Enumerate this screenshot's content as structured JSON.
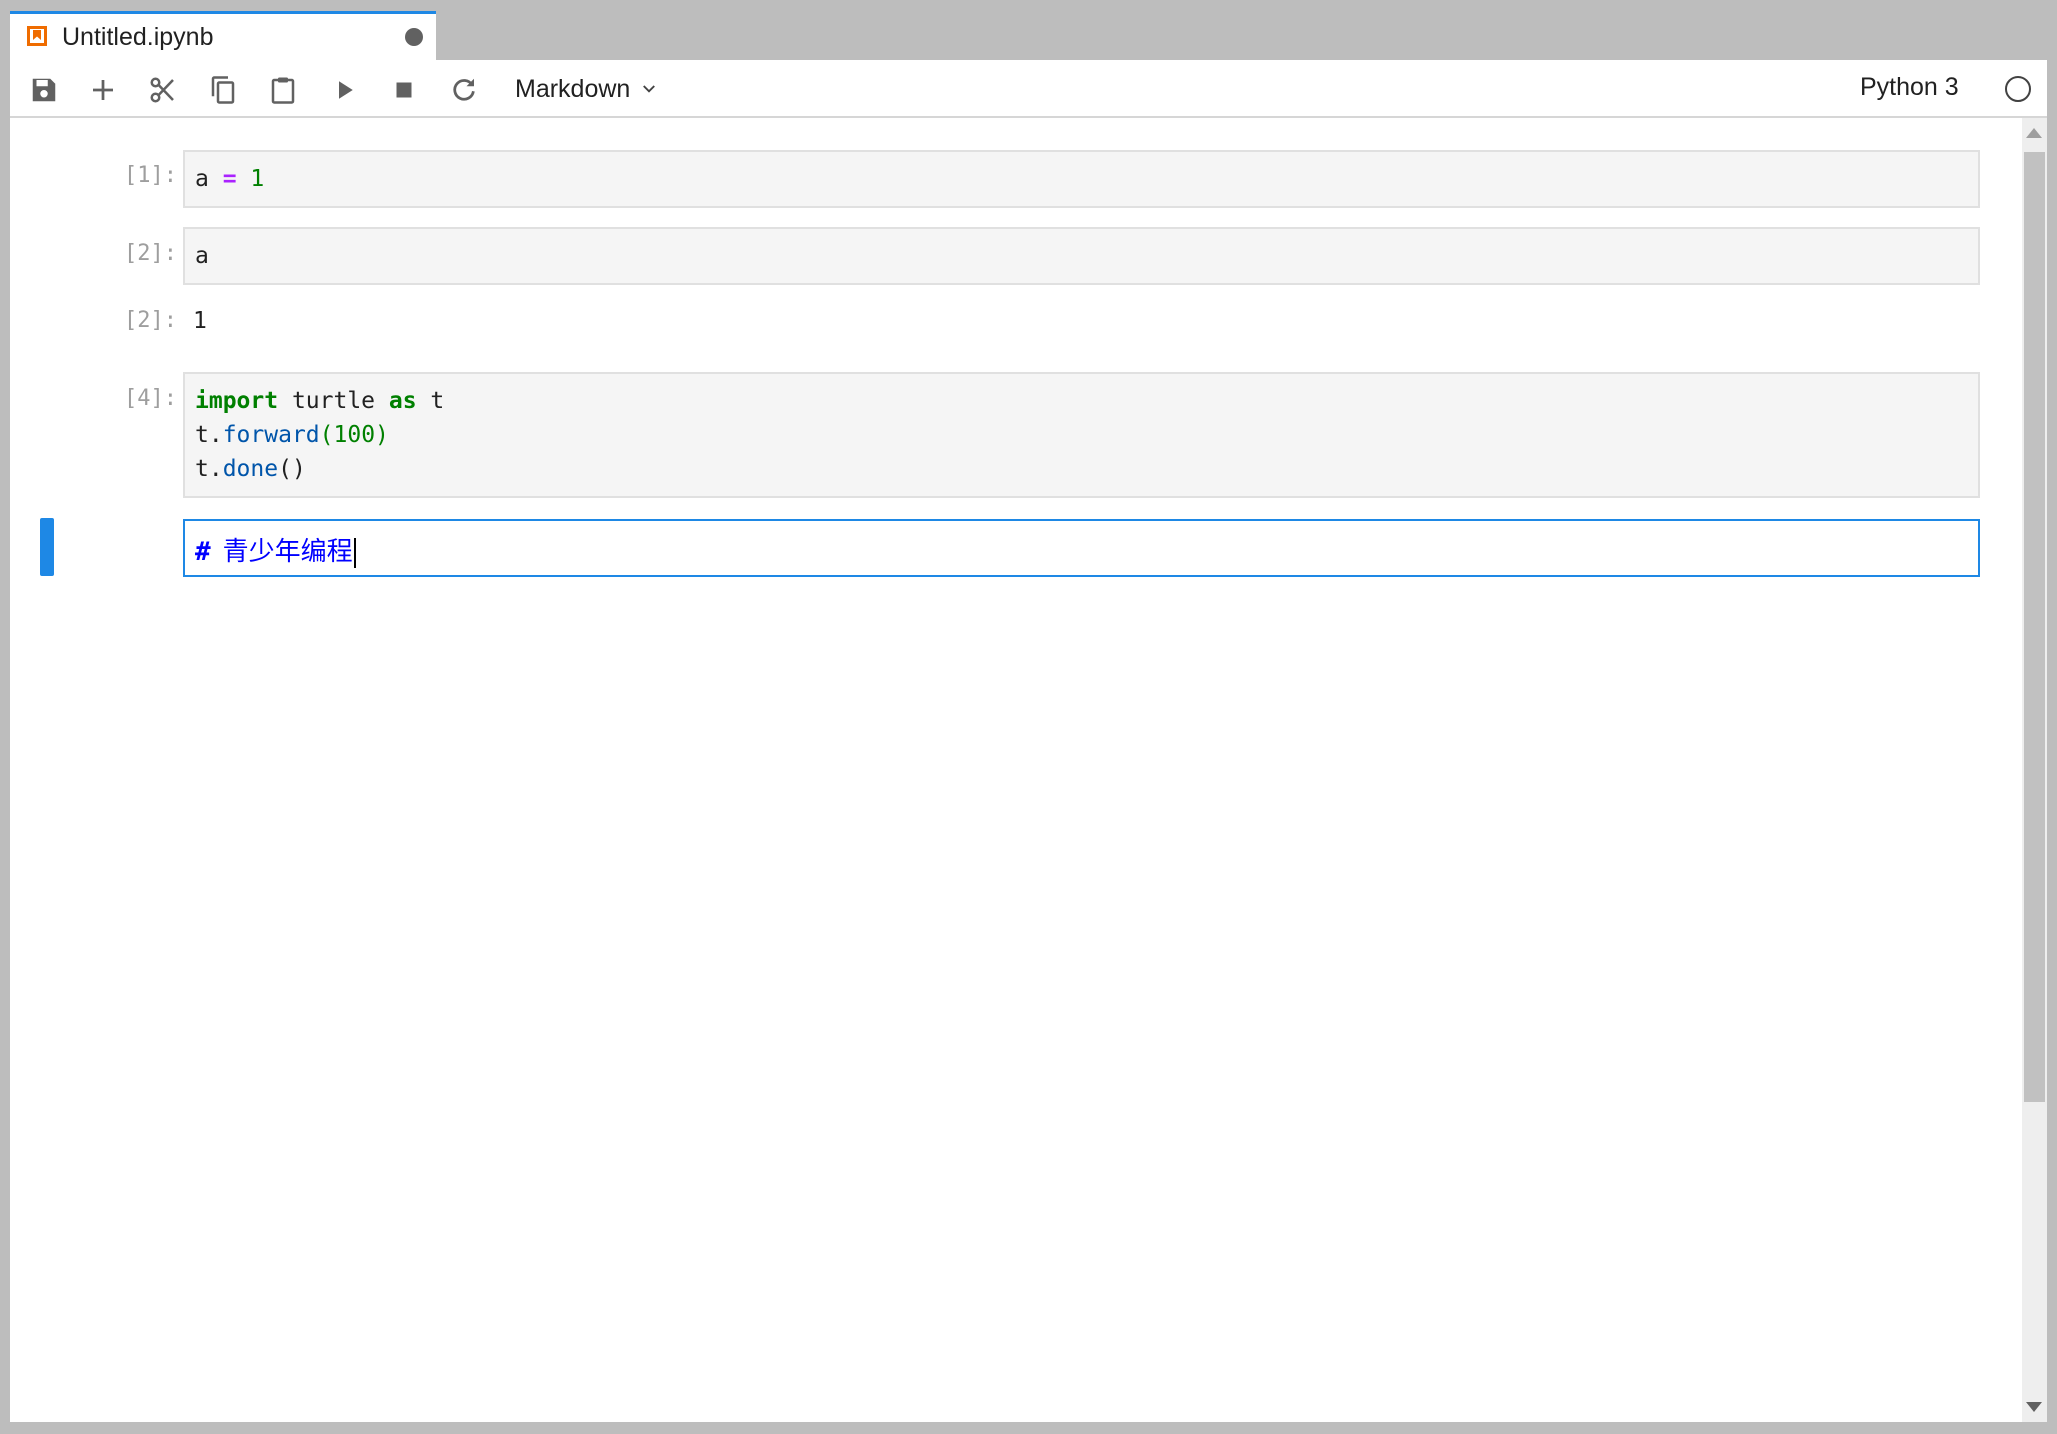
{
  "tab": {
    "title": "Untitled.ipynb",
    "icon": "notebook-icon",
    "status": "unsaved-dot"
  },
  "toolbar": {
    "buttons": [
      {
        "name": "save",
        "icon": "save-icon"
      },
      {
        "name": "add-cell",
        "icon": "plus-icon"
      },
      {
        "name": "cut",
        "icon": "scissors-icon"
      },
      {
        "name": "copy",
        "icon": "copy-icon"
      },
      {
        "name": "paste",
        "icon": "paste-icon"
      },
      {
        "name": "run",
        "icon": "play-icon"
      },
      {
        "name": "interrupt",
        "icon": "stop-icon"
      },
      {
        "name": "restart",
        "icon": "refresh-icon"
      }
    ],
    "cell_type": "Markdown",
    "kernel_name": "Python 3",
    "kernel_status": "idle"
  },
  "cells": {
    "c1": {
      "prompt": "[1]:",
      "t1": "a ",
      "t2": "=",
      "t3": " ",
      "t4": "1"
    },
    "c2": {
      "prompt": "[2]:",
      "code": "a"
    },
    "o2": {
      "prompt": "[2]:",
      "value": "1"
    },
    "c4": {
      "prompt": "[4]:",
      "l1": {
        "kw1": "import",
        "mid": " turtle ",
        "kw2": "as",
        "end": " t"
      },
      "l2": {
        "obj": "t.",
        "fn": "forward",
        "open": "(",
        "num": "100",
        "close": ")"
      },
      "l3": {
        "obj": "t.",
        "fn": "done",
        "parens": "()"
      }
    },
    "md": {
      "hash": "#",
      "text": "青少年编程"
    }
  },
  "colors": {
    "accent": "#1e88e5",
    "keyword": "#008000",
    "operator": "#aa22ff",
    "function": "#0055aa",
    "markdown_heading": "#0000ff"
  }
}
